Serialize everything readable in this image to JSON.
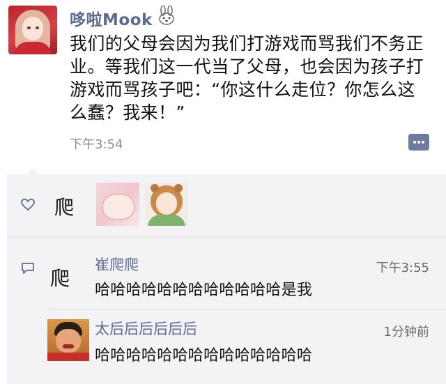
{
  "post": {
    "author": "哆啦Mook",
    "text": "我们的父母会因为我们打游戏而骂我们不务正业。等我们这一代当了父母，也会因为孩子打游戏而骂孩子吧：“你这什么走位？你怎么这么蠢？我来！”",
    "time": "下午3:54",
    "author_icon": "rabbit-icon"
  },
  "likes": {
    "icon": "heart-icon",
    "names": [
      "爬"
    ]
  },
  "comments": [
    {
      "avatar_text": "爬",
      "name": "崔爬爬",
      "time": "下午3:55",
      "text": "哈哈哈哈哈哈哈哈哈哈哈哈是我"
    },
    {
      "name": "太后后后后后后",
      "time": "1分钟前",
      "text": "哈哈哈哈哈哈哈哈哈哈哈哈哈哈"
    }
  ],
  "colors": {
    "name_link": "#5c6b8f",
    "panel_bg": "#f3f3f5",
    "timestamp": "#8c8c8c"
  }
}
